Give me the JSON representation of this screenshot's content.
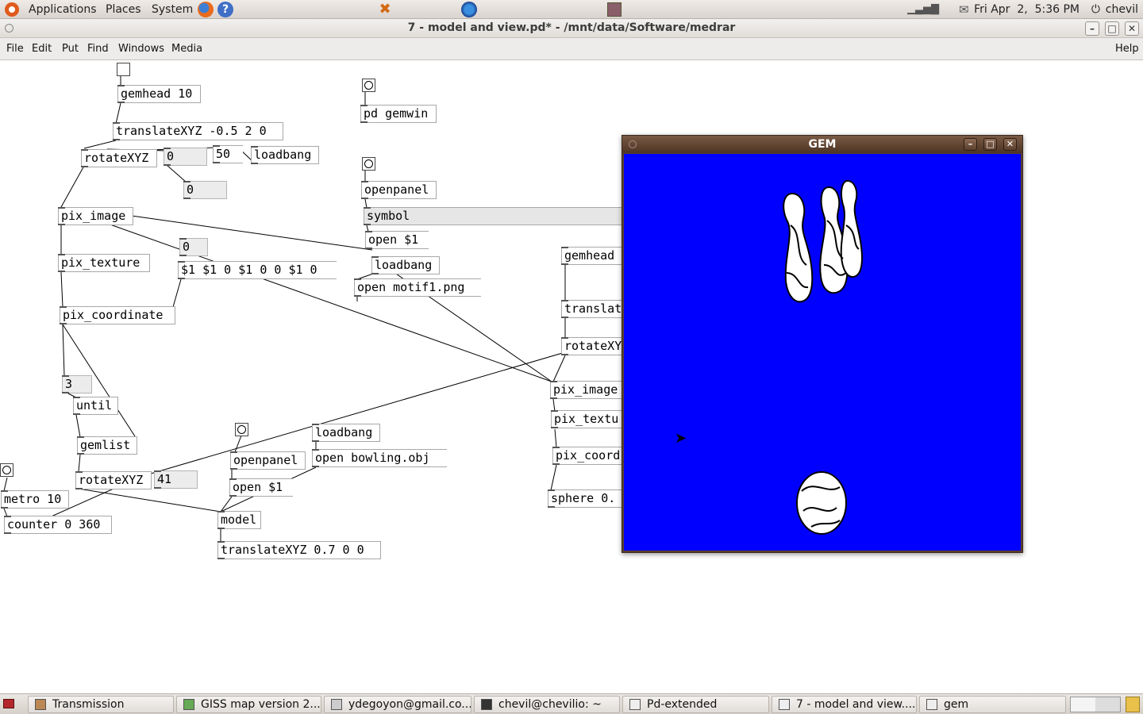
{
  "top_panel": {
    "menus": [
      "Applications",
      "Places",
      "System"
    ],
    "clock": "Fri Apr  2,  5:36 PM",
    "user": "chevil",
    "icons": [
      "ubuntu-logo-icon",
      "firefox-icon",
      "help-icon",
      "transmission-icon",
      "app-icon",
      "app-icon",
      "network-icon",
      "volume-icon",
      "mail-icon",
      "power-icon"
    ]
  },
  "pd_window": {
    "title": "7 - model and view.pd* - /mnt/data/Software/medrar",
    "menu": [
      "File",
      "Edit",
      "Put",
      "Find",
      "Windows",
      "Media"
    ],
    "help": "Help"
  },
  "patch": {
    "objects": {
      "gemhead10": "gemhead 10",
      "translate1": "translateXYZ -0.5 2 0",
      "rotate1": "rotateXYZ",
      "num_rot1": "0",
      "msg50": "50",
      "loadbang1": "loadbang",
      "num0_b": "0",
      "pix_image1": "pix_image",
      "num0_c": "0",
      "pix_texture1": "pix_texture",
      "msg_dollar": "$1 $1 0 $1 0 0 $1 0",
      "pix_coord1": "pix_coordinate",
      "num3": "3",
      "until": "until",
      "gemlist": "gemlist",
      "rotate2": "rotateXYZ",
      "num41": "41",
      "metro": "metro 10",
      "counter": "counter 0 360",
      "pd_gemwin": "pd gemwin",
      "openpanel1": "openpanel",
      "symbol": "symbol",
      "open1": "open $1",
      "loadbang2": "loadbang",
      "open_motif": "open motif1.png",
      "gemhead2": "gemhead",
      "translate2": "translat",
      "rotate3": "rotateXY",
      "pix_image2": "pix_image",
      "pix_texture2": "pix_textu",
      "pix_coord2": "pix_coord",
      "sphere": "sphere 0.",
      "loadbang3": "loadbang",
      "open_bowling": "open bowling.obj",
      "openpanel2": "openpanel",
      "open2": "open $1",
      "model": "model",
      "translate3": "translateXYZ 0.7 0 0"
    }
  },
  "gem_window": {
    "title": "GEM",
    "background": "#0000fe"
  },
  "taskbar": {
    "items": [
      "Transmission",
      "GISS map version 2....",
      "ydegoyon@gmail.co...",
      "chevil@chevilio: ~",
      "Pd-extended",
      "7 - model and view....",
      "gem"
    ]
  }
}
